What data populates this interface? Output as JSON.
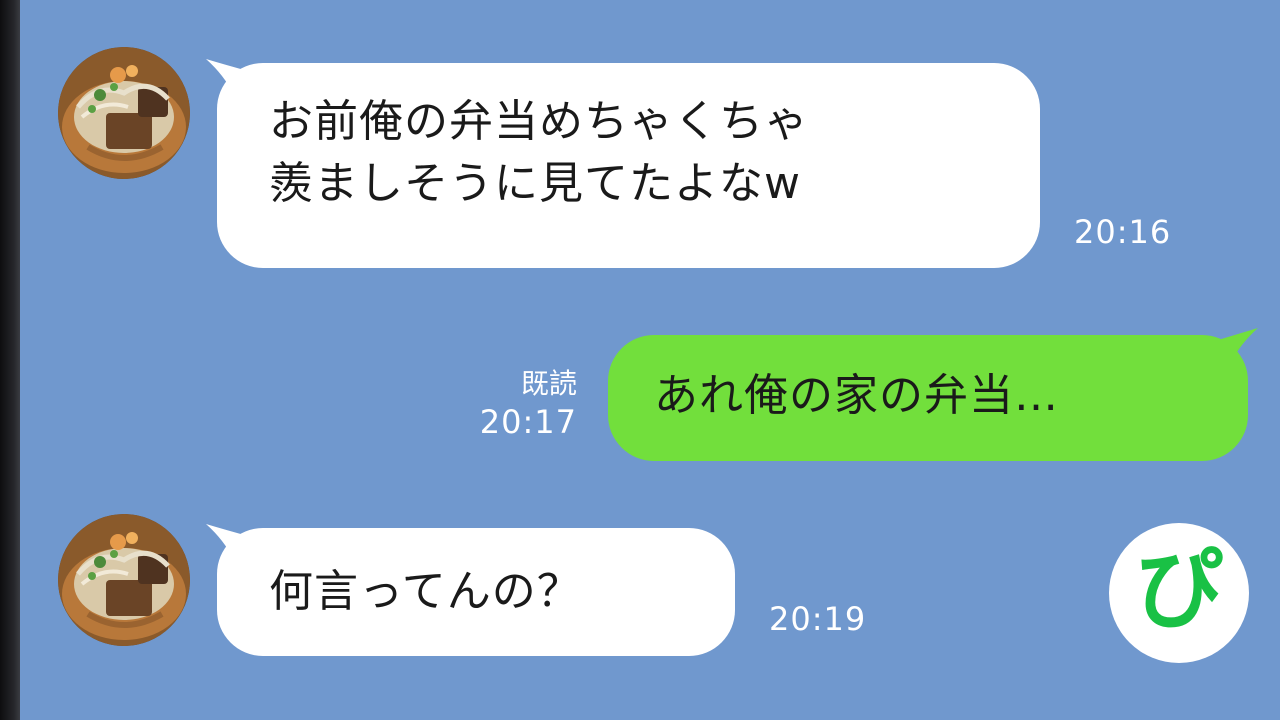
{
  "chat": {
    "messages": [
      {
        "direction": "incoming",
        "lines": [
          "お前俺の弁当めちゃくちゃ",
          "羨ましそうに見てたよなw"
        ],
        "time": "20:16"
      },
      {
        "direction": "outgoing",
        "lines": [
          "あれ俺の家の弁当…"
        ],
        "read_label": "既読",
        "time": "20:17"
      },
      {
        "direction": "incoming",
        "lines": [
          "何言ってんの？"
        ],
        "time": "20:19"
      }
    ]
  },
  "watermark": {
    "text": "ぴ",
    "color": "#19c145"
  },
  "colors": {
    "background": "#7098ce",
    "incoming_bubble": "#ffffff",
    "outgoing_bubble": "#72df3c"
  }
}
